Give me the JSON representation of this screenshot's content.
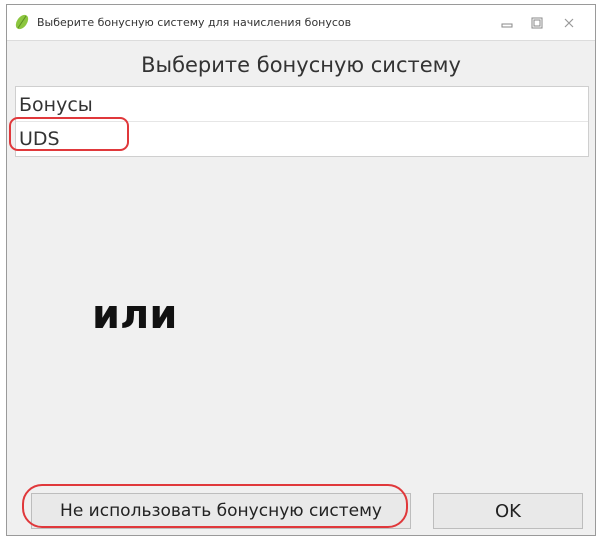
{
  "window": {
    "title": "Выберите бонусную систему для начисления бонусов",
    "controls": [
      "minimize",
      "maximize",
      "close"
    ]
  },
  "dialog": {
    "heading": "Выберите бонусную систему",
    "list_items": [
      {
        "label": "Бонусы"
      },
      {
        "label": "UDS"
      }
    ],
    "annotation_text": "или",
    "buttons": {
      "no_bonus_label": "Не использовать бонусную систему",
      "ok_label": "OK"
    }
  },
  "colors": {
    "highlight": "#e0383b",
    "window_bg": "#f0f0f0",
    "app_icon": "#8cc63f"
  },
  "icons": [
    "app-leaf-icon",
    "minimize-icon",
    "maximize-icon",
    "close-icon"
  ]
}
